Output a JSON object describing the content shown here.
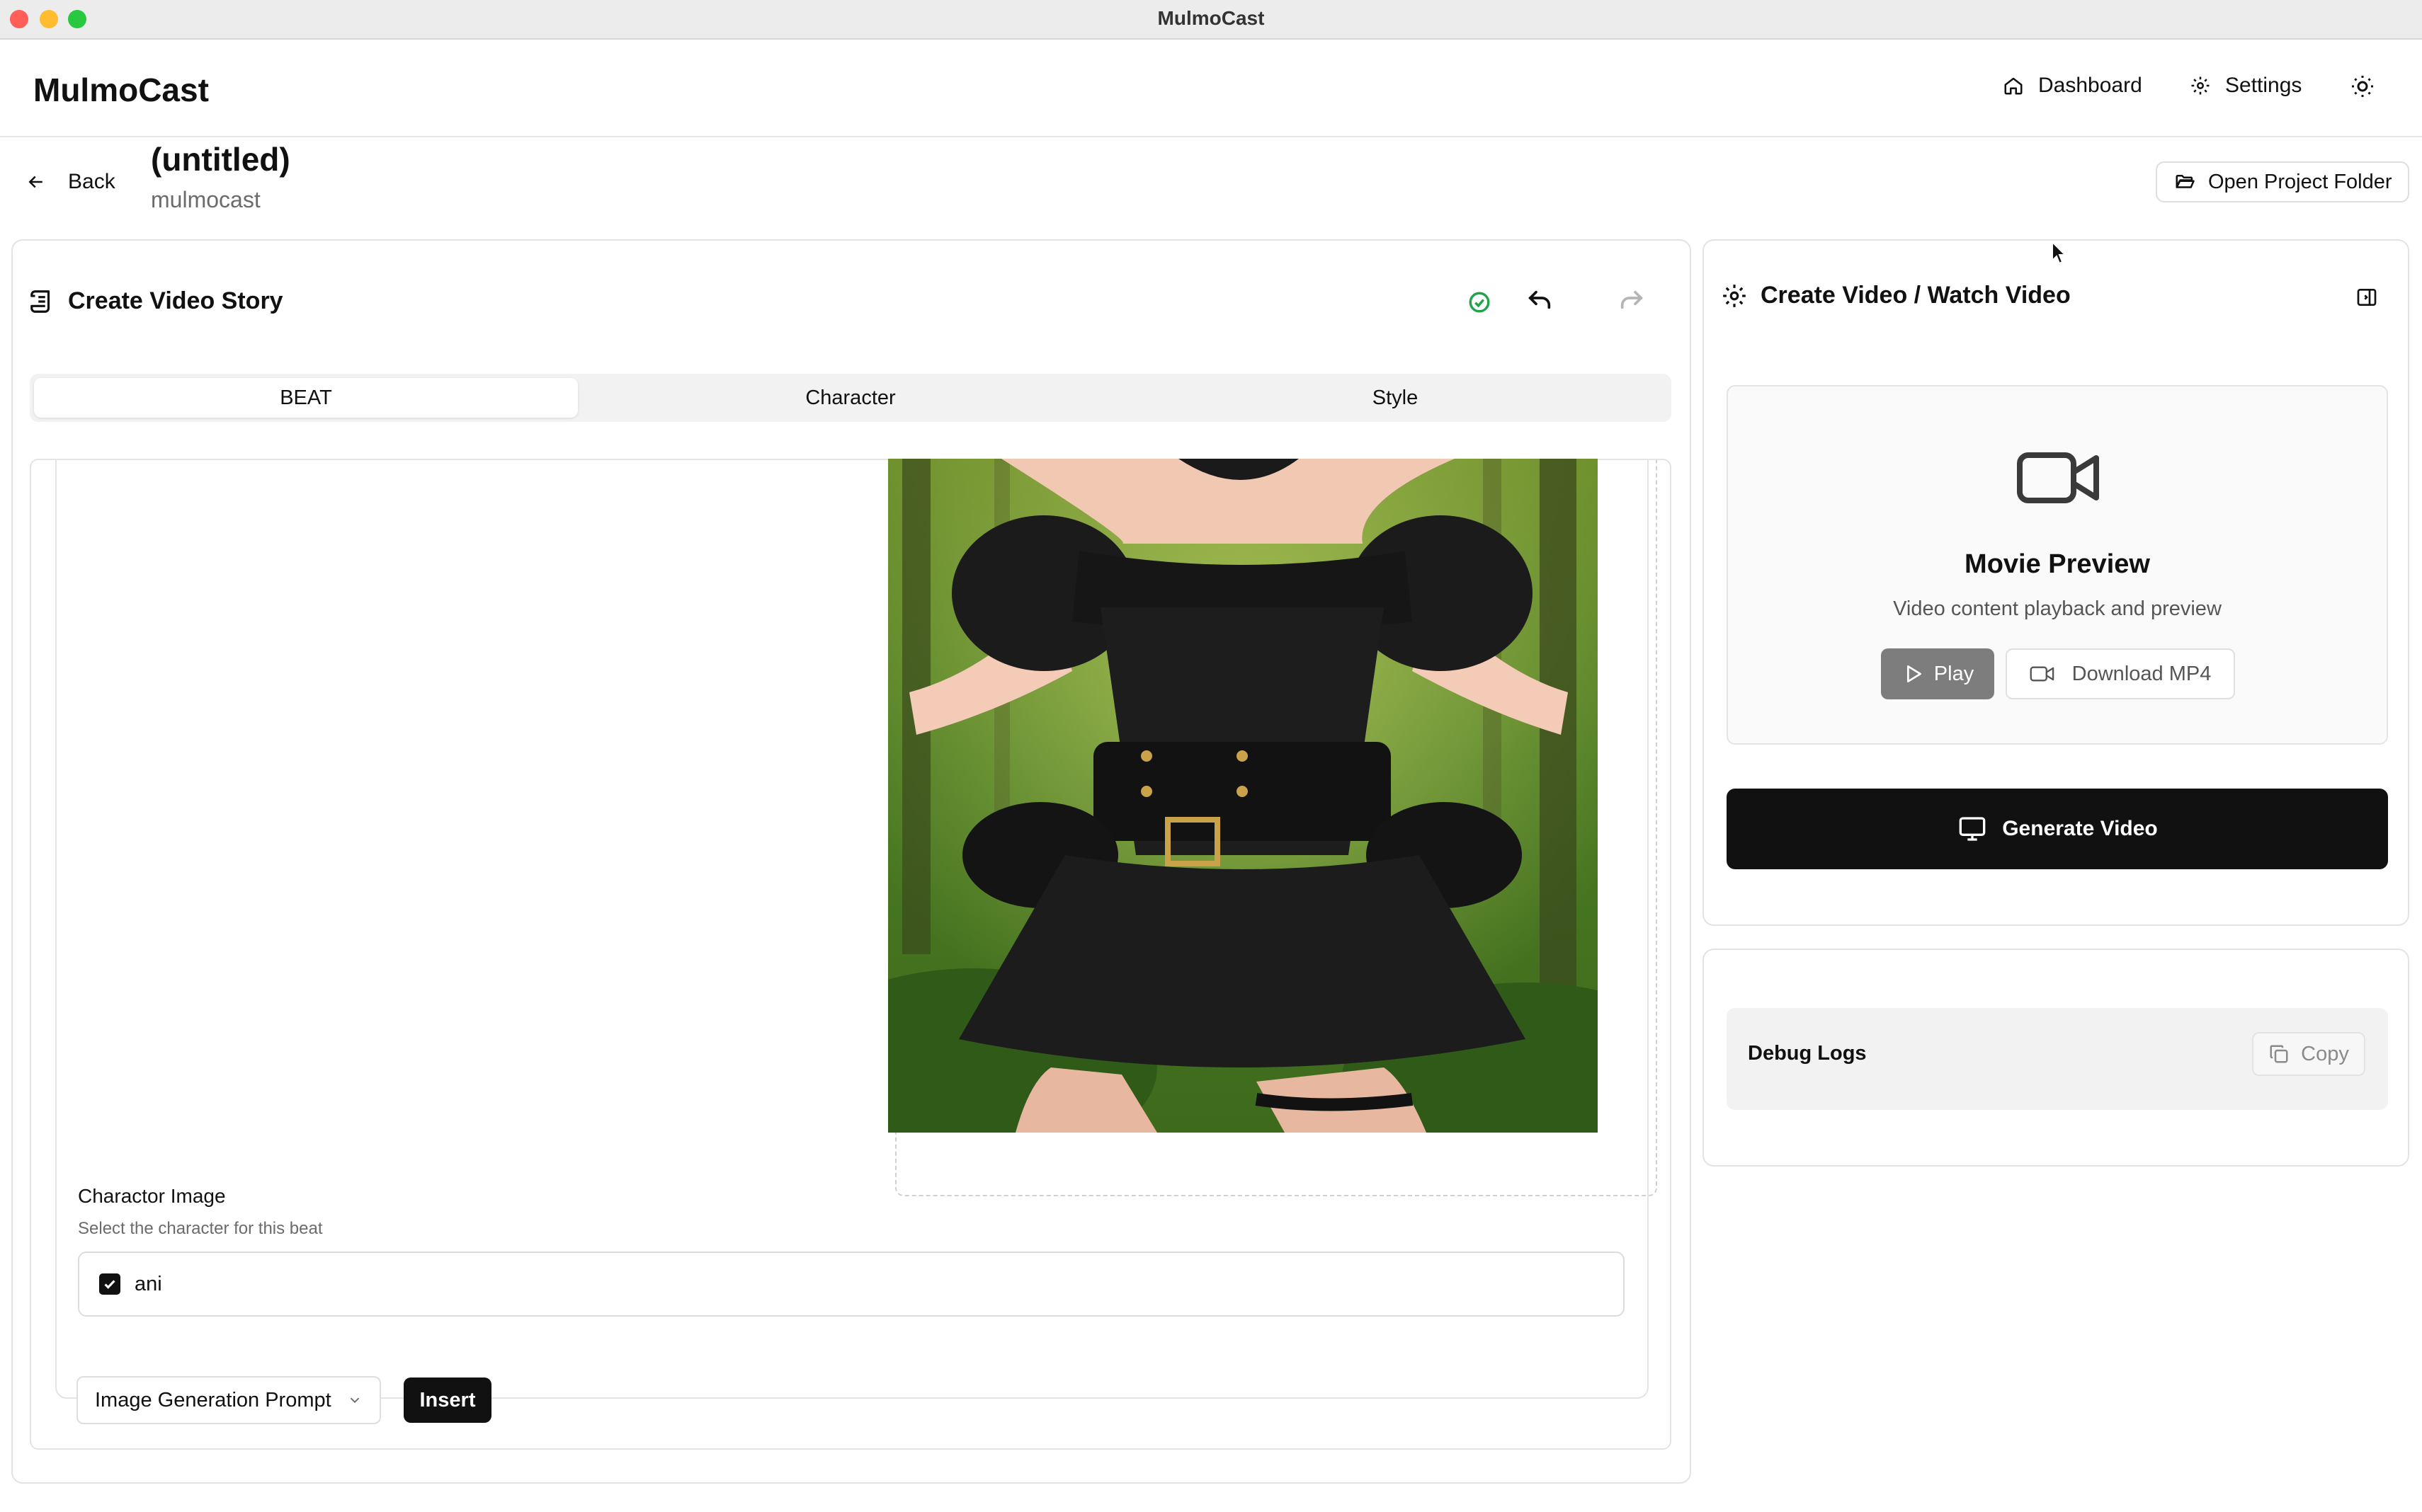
{
  "window": {
    "title": "MulmoCast"
  },
  "header": {
    "brand": "MulmoCast",
    "dashboard_label": "Dashboard",
    "settings_label": "Settings",
    "theme_icon": "sun-icon"
  },
  "project": {
    "back_label": "Back",
    "title": "(untitled)",
    "subtitle": "mulmocast",
    "open_folder_label": "Open Project Folder"
  },
  "editor": {
    "title": "Create Video Story",
    "tabs": [
      {
        "label": "BEAT"
      },
      {
        "label": "Character"
      },
      {
        "label": "Style"
      }
    ],
    "active_tab": "BEAT",
    "character_image": {
      "label": "Charactor Image",
      "help": "Select the character for this beat",
      "options": [
        {
          "label": "ani",
          "checked": true
        }
      ]
    },
    "prompt_select": {
      "value": "Image Generation Prompt"
    },
    "insert_label": "Insert"
  },
  "video_panel": {
    "title": "Create Video / Watch Video",
    "preview_title": "Movie Preview",
    "preview_subtitle": "Video content playback and preview",
    "play_label": "Play",
    "download_label": "Download MP4",
    "generate_label": "Generate Video"
  },
  "debug": {
    "title": "Debug Logs",
    "copy_label": "Copy"
  },
  "colors": {
    "accent_green": "#22a34a",
    "primary_dark": "#111111",
    "play_gray": "#7d7d7d"
  }
}
